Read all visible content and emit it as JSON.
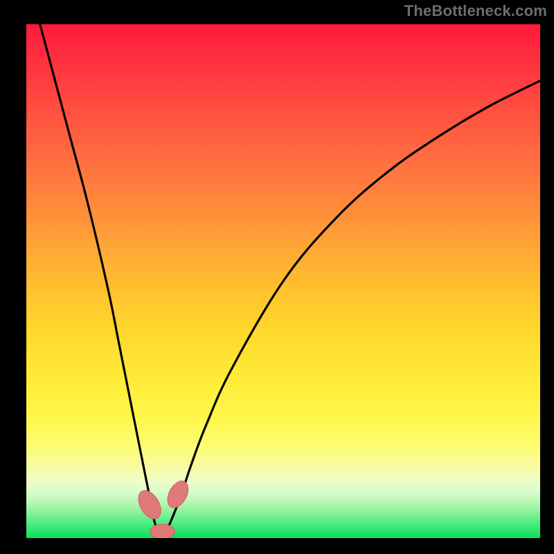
{
  "attribution": "TheBottleneck.com",
  "chart_data": {
    "type": "line",
    "title": "",
    "xlabel": "",
    "ylabel": "",
    "xlim": [
      0,
      100
    ],
    "ylim": [
      0,
      100
    ],
    "series": [
      {
        "name": "bottleneck-curve",
        "x": [
          0,
          4,
          8,
          12,
          16,
          18,
          20,
          22,
          24,
          25,
          26,
          27,
          28,
          30,
          32,
          35,
          40,
          50,
          60,
          70,
          80,
          90,
          100
        ],
        "values": [
          110,
          95,
          80,
          65,
          48,
          38,
          28,
          18,
          8,
          3,
          1,
          1,
          3,
          8,
          14,
          22,
          33,
          50,
          62,
          71,
          78,
          84,
          89
        ]
      }
    ],
    "markers": [
      {
        "name": "left-cluster-marker",
        "x": 24.0,
        "y": 6.5,
        "rx": 1.8,
        "ry": 3.0,
        "rot": -30
      },
      {
        "name": "valley-marker",
        "x": 26.5,
        "y": 1.3,
        "rx": 2.4,
        "ry": 1.4,
        "rot": 0
      },
      {
        "name": "right-cluster-marker",
        "x": 29.5,
        "y": 8.5,
        "rx": 1.7,
        "ry": 2.8,
        "rot": 28
      }
    ],
    "colors": {
      "curve": "#000000",
      "marker_fill": "#e07a7a",
      "marker_stroke": "#d45c5c",
      "top_gradient": "#ff1a3a",
      "bottom_gradient": "#06e25a"
    }
  }
}
